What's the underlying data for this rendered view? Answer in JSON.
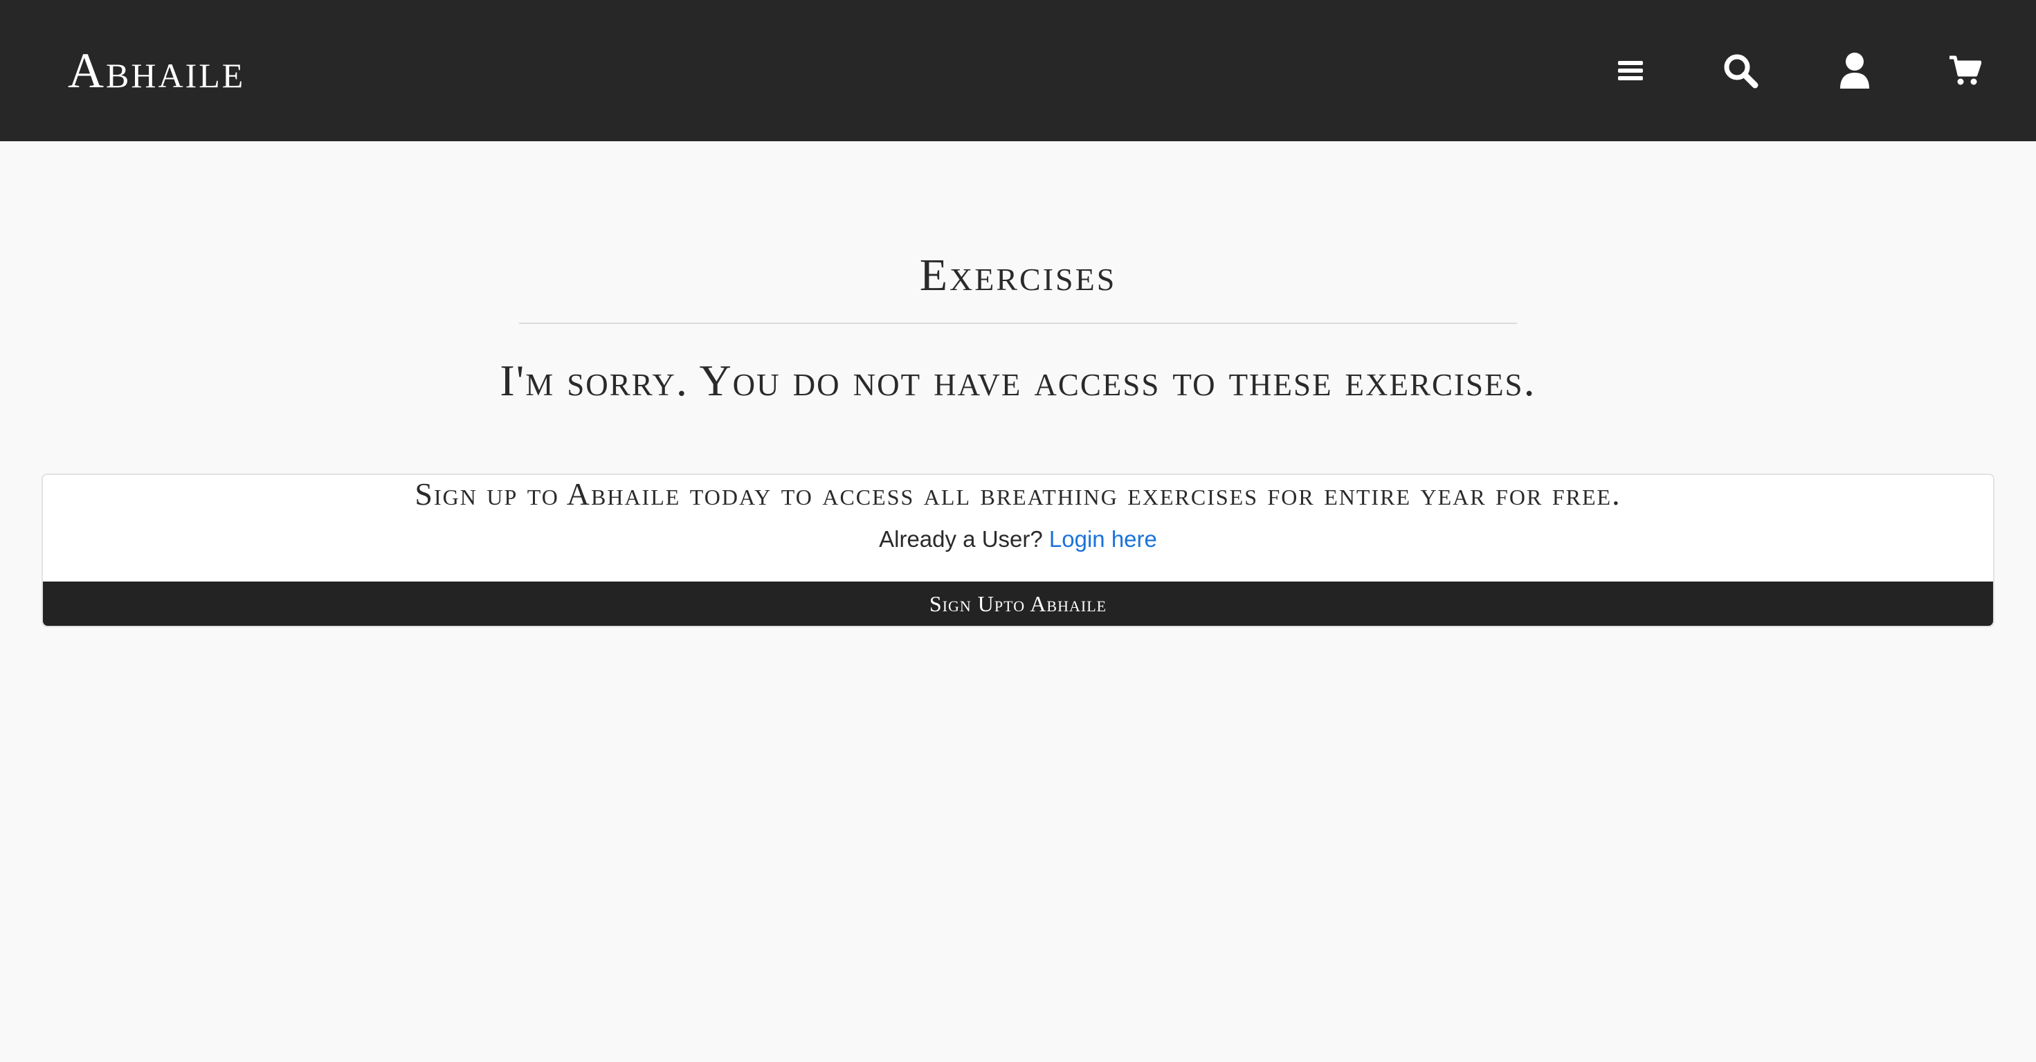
{
  "header": {
    "brand": "Abhaile",
    "icons": [
      "menu-icon",
      "search-icon",
      "user-icon",
      "cart-icon"
    ]
  },
  "main": {
    "title": "Exercises",
    "message": "I'm sorry. You do not have access to these exercises."
  },
  "signup_card": {
    "heading": "Sign up to Abhaile today to access all breathing exercises for entire year for free.",
    "login_prompt": "Already a User?",
    "login_link": "Login here",
    "button_label": "Sign Upto Abhaile"
  },
  "colors": {
    "navbar": "#272727",
    "page_background": "#f9f9f9",
    "link": "#1a73d9",
    "button": "#232323"
  }
}
